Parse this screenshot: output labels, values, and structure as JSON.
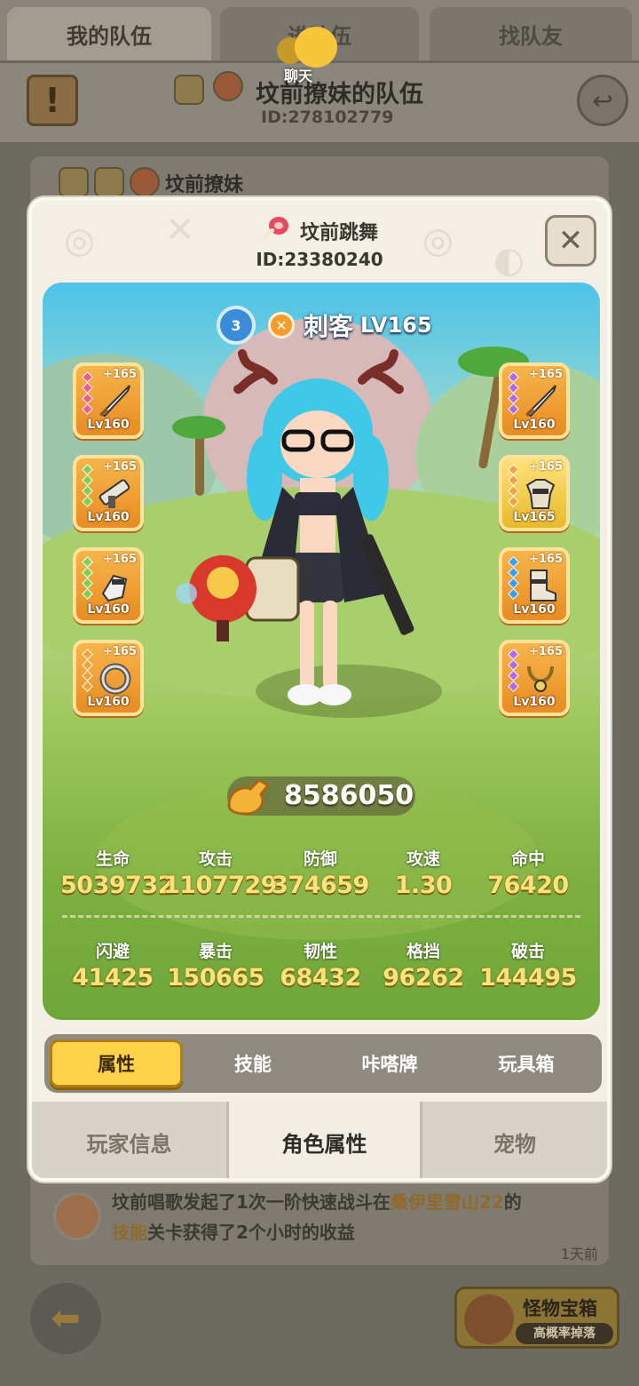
{
  "top_tabs": [
    "我的队伍",
    "进队伍",
    "找队友"
  ],
  "chat": {
    "label": "聊天"
  },
  "team": {
    "title": "坟前撩妹的队伍",
    "id": "ID:278102779",
    "member_name": "坟前撩妹"
  },
  "character": {
    "name": "坟前跳舞",
    "id": "ID:23380240",
    "class_name": "刺客",
    "level": "LV165",
    "power": "8586050"
  },
  "equipment_left": [
    {
      "plus": "+165",
      "level": "Lv160",
      "gems": [
        "#f25a8a",
        "#f25a8a",
        "#f25a8a",
        "#f25a8a"
      ],
      "item": "sword"
    },
    {
      "plus": "+165",
      "level": "Lv160",
      "gems": [
        "#7ed04a",
        "#7ed04a",
        "#7ed04a",
        "#7ed04a"
      ],
      "item": "gun"
    },
    {
      "plus": "+165",
      "level": "Lv160",
      "gems": [
        "#7ed04a",
        "#7ed04a",
        "#7ed04a",
        "#7ed04a"
      ],
      "item": "gauntlet"
    },
    {
      "plus": "+165",
      "level": "Lv160",
      "gems": [
        "#f2a23a",
        "#f2a23a",
        "#f2a23a",
        "#f2a23a"
      ],
      "item": "ring"
    }
  ],
  "equipment_right": [
    {
      "plus": "+165",
      "level": "Lv160",
      "gems": [
        "#b06ae0",
        "#b06ae0",
        "#b06ae0",
        "#b06ae0"
      ],
      "item": "sword"
    },
    {
      "plus": "+165",
      "level": "Lv165",
      "gems": [
        "#f2a23a",
        "#f2a23a",
        "#f2a23a",
        "#f2a23a"
      ],
      "item": "armor"
    },
    {
      "plus": "+165",
      "level": "Lv160",
      "gems": [
        "#3a9ef0",
        "#3a9ef0",
        "#3a9ef0",
        "#3a9ef0"
      ],
      "item": "boots"
    },
    {
      "plus": "+165",
      "level": "Lv160",
      "gems": [
        "#b06ae0",
        "#b06ae0",
        "#b06ae0",
        "#b06ae0"
      ],
      "item": "necklace"
    }
  ],
  "stats_row1": [
    {
      "label": "生命",
      "value": "5039732"
    },
    {
      "label": "攻击",
      "value": "1107729"
    },
    {
      "label": "防御",
      "value": "374659"
    },
    {
      "label": "攻速",
      "value": "1.30"
    },
    {
      "label": "命中",
      "value": "76420"
    }
  ],
  "stats_row2": [
    {
      "label": "闪避",
      "value": "41425"
    },
    {
      "label": "暴击",
      "value": "150665"
    },
    {
      "label": "韧性",
      "value": "68432"
    },
    {
      "label": "格挡",
      "value": "96262"
    },
    {
      "label": "破击",
      "value": "144495"
    }
  ],
  "attr_tabs": [
    "属性",
    "技能",
    "咔嗒牌",
    "玩具箱"
  ],
  "bottom_tabs": [
    "玩家信息",
    "角色属性",
    "宠物"
  ],
  "feed": {
    "player": "坟前唱歌",
    "text1": "发起了1次一阶快速战斗在",
    "place": "桑伊里雪山22",
    "text2": "的",
    "skill": "技能",
    "text3": "关卡获得了2个小时的收益",
    "time": "1天前"
  },
  "chest": {
    "title": "怪物宝箱",
    "subtitle": "高概率掉落"
  },
  "colors": {
    "accent_gold": "#ffd24a",
    "stat_value": "#ffe27a",
    "equip_orange": "#e88b23"
  }
}
